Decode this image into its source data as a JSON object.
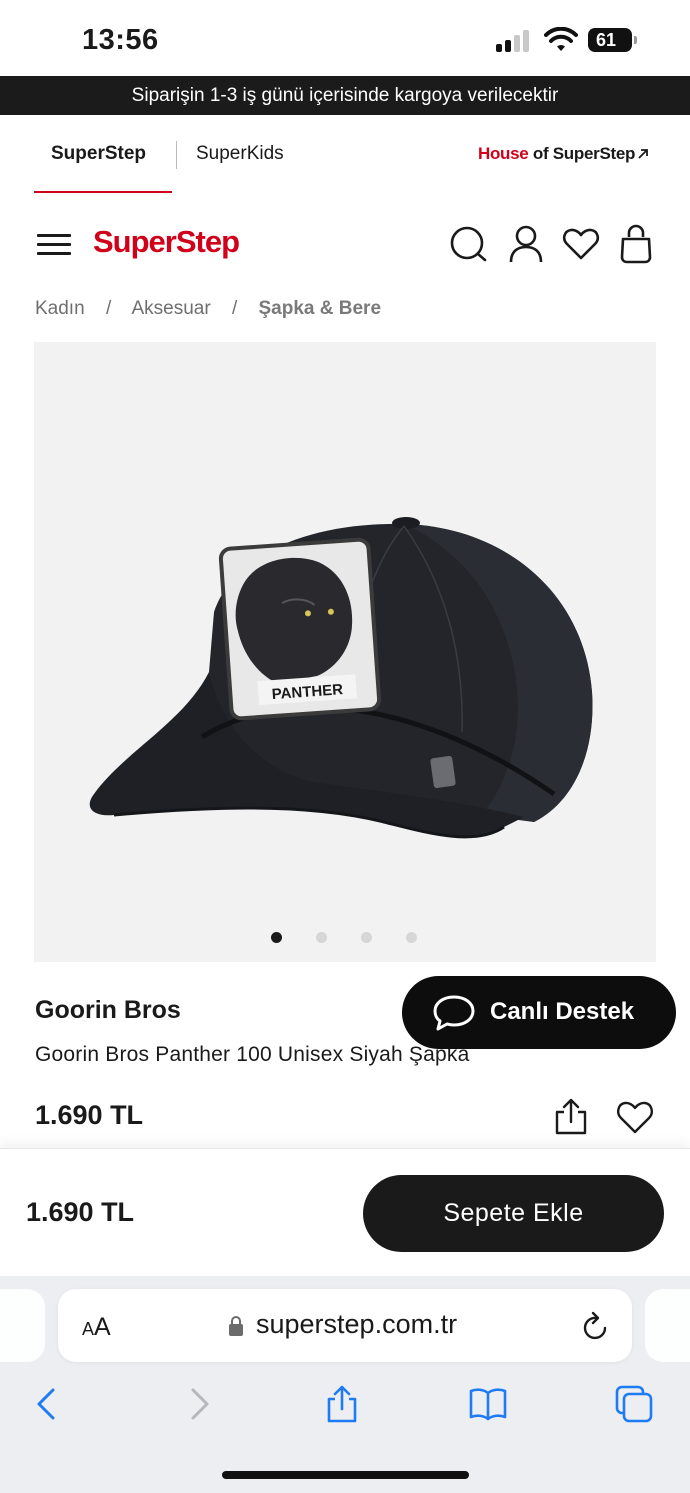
{
  "status_bar": {
    "time": "13:56",
    "battery": "61",
    "signal_icon": "cellular-signal-icon",
    "wifi_icon": "wifi-icon"
  },
  "announcement": "Siparişin 1-3 iş günü içerisinde kargoya verilecektir",
  "brand_tabs": {
    "tabs": [
      {
        "label": "SuperStep",
        "active": true
      },
      {
        "label": "SuperKids",
        "active": false
      }
    ],
    "house_link": {
      "part1": "House",
      "part2": " of SuperStep",
      "icon": "external-arrow-icon"
    }
  },
  "header": {
    "logo": "SuperStep",
    "icons": [
      "menu-icon",
      "search-icon",
      "account-icon",
      "favorites-icon",
      "cart-bag-icon"
    ]
  },
  "breadcrumb": {
    "items": [
      "Kadın",
      "Aksesuar",
      "Şapka & Bere"
    ],
    "separator": "/"
  },
  "product": {
    "patch_text": "PANTHER",
    "carousel": {
      "count": 4,
      "active_index": 0
    },
    "brand": "Goorin Bros",
    "name": "Goorin Bros Panther 100 Unisex Siyah Şapka",
    "price": "1.690 TL"
  },
  "live_support": {
    "label": "Canlı Destek",
    "icon": "chat-bubble-icon"
  },
  "cart_bar": {
    "price": "1.690 TL",
    "button_label": "Sepete Ekle"
  },
  "browser": {
    "aa_small": "A",
    "aa_large": "A",
    "url": "superstep.com.tr",
    "toolbar": [
      "back-icon",
      "forward-icon",
      "share-icon",
      "bookmarks-icon",
      "tabs-icon"
    ]
  },
  "colors": {
    "brand_red": "#d0021b",
    "dark": "#1a1a1a",
    "image_bg": "#f2f2f2"
  }
}
